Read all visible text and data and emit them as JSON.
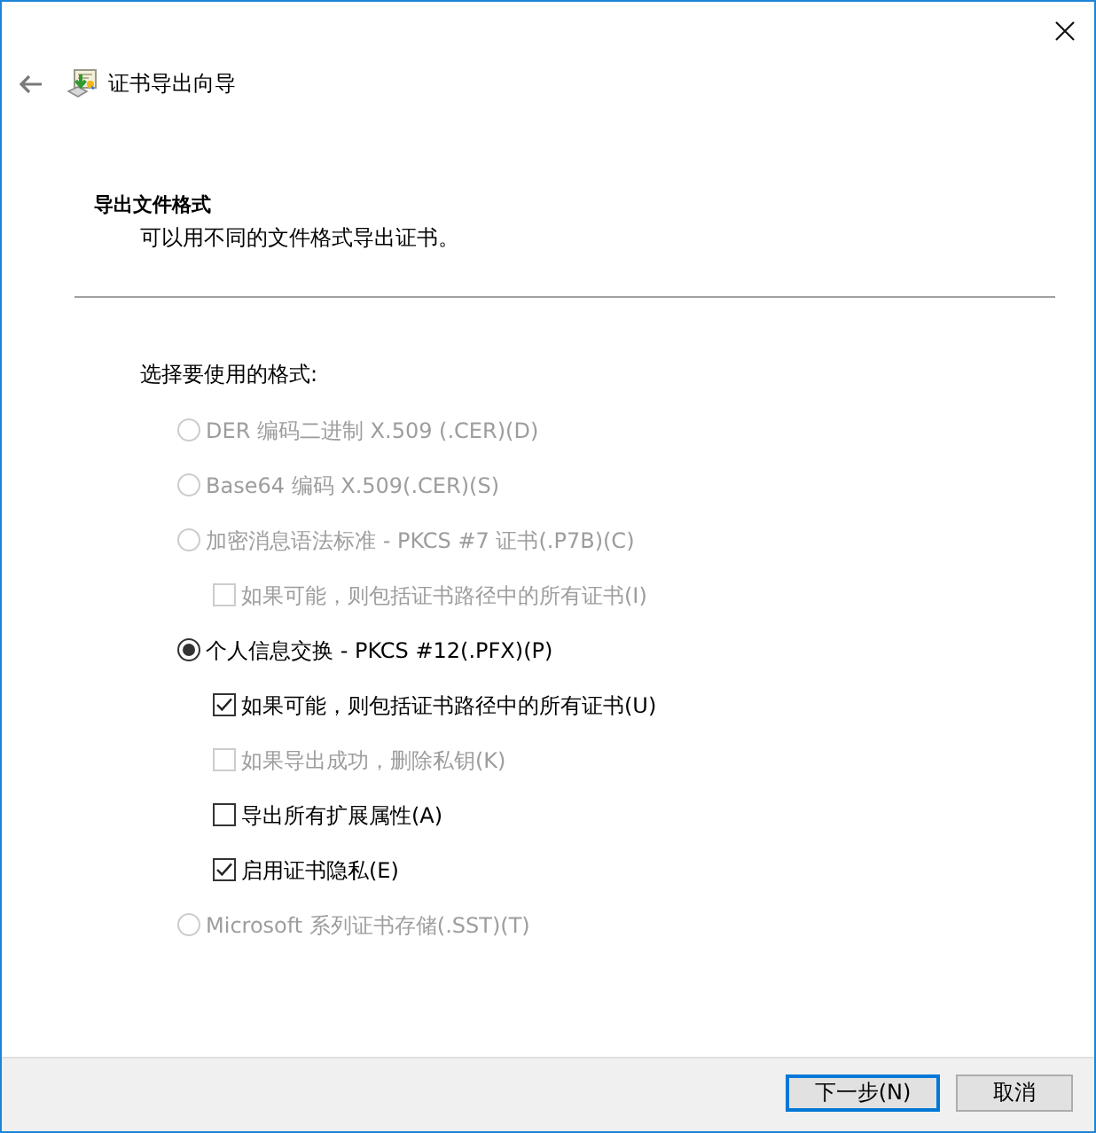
{
  "window": {
    "title": "证书导出向导"
  },
  "header": {
    "title": "导出文件格式",
    "subtitle": "可以用不同的文件格式导出证书。"
  },
  "prompt": "选择要使用的格式:",
  "options": [
    {
      "label": "DER 编码二进制 X.509 (.CER)(D)",
      "selected": false,
      "disabled": true
    },
    {
      "label": "Base64 编码 X.509(.CER)(S)",
      "selected": false,
      "disabled": true
    },
    {
      "label": "加密消息语法标准 - PKCS #7 证书(.P7B)(C)",
      "selected": false,
      "disabled": true,
      "children": [
        {
          "label": "如果可能，则包括证书路径中的所有证书(I)",
          "checked": false,
          "disabled": true
        }
      ]
    },
    {
      "label": "个人信息交换 - PKCS #12(.PFX)(P)",
      "selected": true,
      "disabled": false,
      "children": [
        {
          "label": "如果可能，则包括证书路径中的所有证书(U)",
          "checked": true,
          "disabled": false
        },
        {
          "label": "如果导出成功，删除私钥(K)",
          "checked": false,
          "disabled": true
        },
        {
          "label": "导出所有扩展属性(A)",
          "checked": false,
          "disabled": false
        },
        {
          "label": "启用证书隐私(E)",
          "checked": true,
          "disabled": false
        }
      ]
    },
    {
      "label": "Microsoft 系列证书存储(.SST)(T)",
      "selected": false,
      "disabled": true
    }
  ],
  "buttons": [
    {
      "label": "下一步(N)",
      "default": true
    },
    {
      "label": "取消",
      "default": false
    }
  ]
}
